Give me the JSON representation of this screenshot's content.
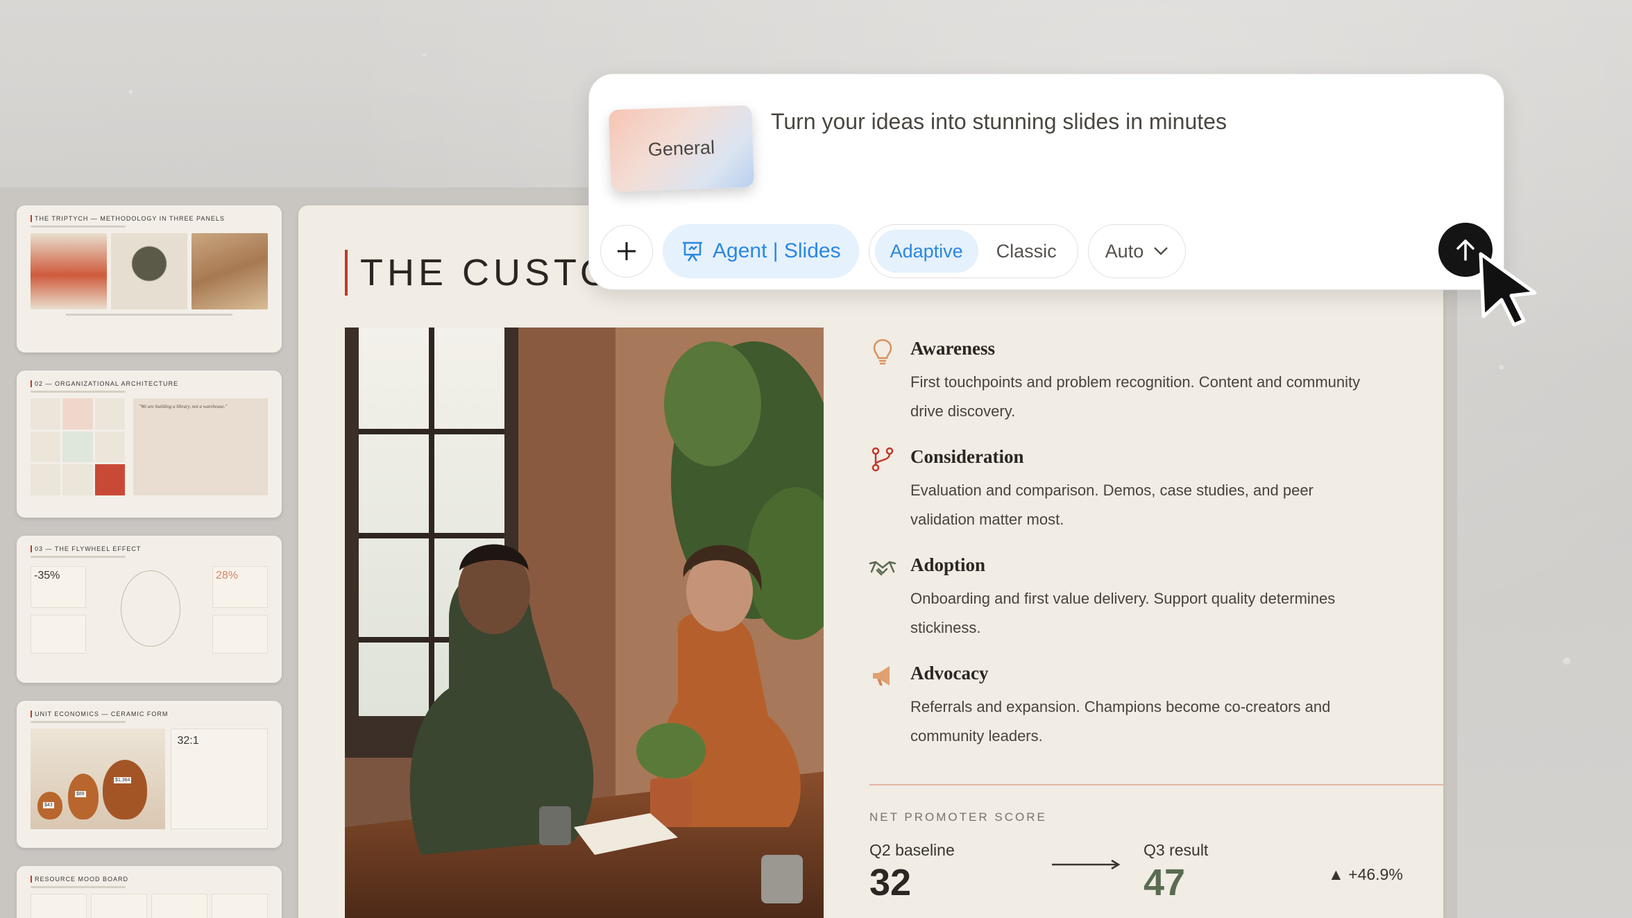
{
  "prompt": {
    "mode_chip": "General",
    "placeholder": "Turn your ideas into stunning slides in minutes",
    "agent_label": "Agent | Slides",
    "style_options": [
      "Adaptive",
      "Classic"
    ],
    "selected_style": "Adaptive",
    "auto_label": "Auto",
    "accent_color": "#2b87e0"
  },
  "sidebar": {
    "thumbs": [
      {
        "title": "THE TRIPTYCH — METHODOLOGY IN THREE PANELS"
      },
      {
        "title": "02 — ORGANIZATIONAL ARCHITECTURE",
        "quote": "\"We are building a library, not a warehouse.\""
      },
      {
        "title": "03 — THE FLYWHEEL EFFECT",
        "stat_left": "-35%",
        "stat_right": "28%"
      },
      {
        "title": "UNIT ECONOMICS — CERAMIC FORM",
        "ratio": "32:1",
        "price_tags": [
          "$43",
          "$89",
          "$1,364"
        ]
      },
      {
        "title": "RESOURCE MOOD BOARD"
      }
    ]
  },
  "slide": {
    "title": "THE CUSTO",
    "stages": [
      {
        "name": "Awareness",
        "icon": "lightbulb-icon",
        "desc": "First touchpoints and problem recognition. Content and community drive discovery."
      },
      {
        "name": "Consideration",
        "icon": "branch-icon",
        "desc": "Evaluation and comparison. Demos, case studies, and peer validation matter most."
      },
      {
        "name": "Adoption",
        "icon": "handshake-icon",
        "desc": "Onboarding and first value delivery. Support quality determines stickiness."
      },
      {
        "name": "Advocacy",
        "icon": "megaphone-icon",
        "desc": "Referrals and expansion. Champions become co-creators and community leaders."
      }
    ],
    "nps": {
      "label": "NET PROMOTER SCORE",
      "baseline_label": "Q2 baseline",
      "baseline_value": "32",
      "result_label": "Q3 result",
      "result_value": "47",
      "delta": "▲ +46.9%",
      "accent_color": "#c0392b",
      "result_color": "#5a6b52"
    }
  }
}
